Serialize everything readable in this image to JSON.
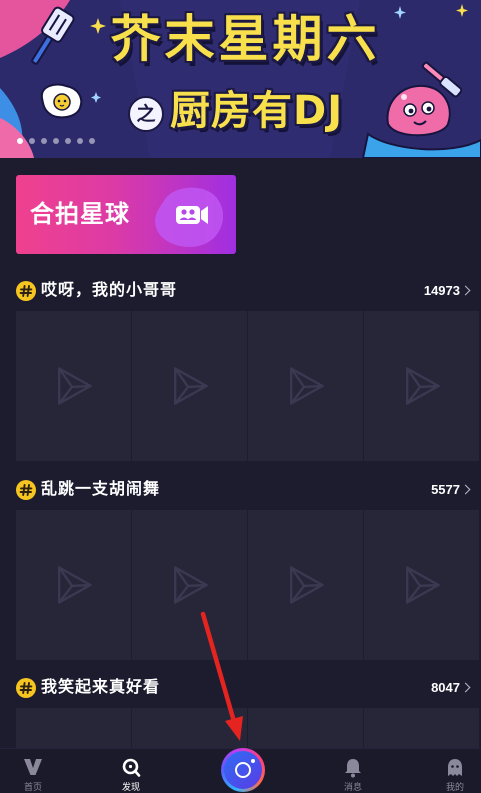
{
  "banner": {
    "title_line1": "芥末星期六",
    "connector": "之",
    "title_line2": "厨房有DJ",
    "slides": 7,
    "active_slide": 0
  },
  "duet_card": {
    "label": "合拍星球",
    "icon": "duet-camera-icon"
  },
  "topic_badge_icon": "hashtag-icon",
  "thumbnail_icon": "play-placeholder-icon",
  "topics": [
    {
      "title": "哎呀，我的小哥哥",
      "count": "14973"
    },
    {
      "title": "乱跳一支胡闹舞",
      "count": "5577"
    },
    {
      "title": "我笑起来真好看",
      "count": "8047"
    }
  ],
  "bottom_nav": {
    "items": [
      {
        "label": "首页",
        "icon": "home-v-logo-icon",
        "active": false
      },
      {
        "label": "发现",
        "icon": "discover-icon",
        "active": true
      },
      {
        "label": "",
        "icon": "camera-record-icon",
        "active": false
      },
      {
        "label": "消息",
        "icon": "bell-icon",
        "active": false
      },
      {
        "label": "我的",
        "icon": "profile-icon",
        "active": false
      }
    ]
  },
  "annotation": {
    "shape": "arrow",
    "color": "#e52420"
  },
  "colors": {
    "page_bg": "#1d1b2e",
    "tile_bg": "#272538",
    "tile_icon": "#3b3951",
    "text": "#ffffff",
    "muted": "#8a889a",
    "topic_badge": "#f6c520",
    "nav_bg": "#1b1a2a",
    "banner_title": "#f8e04c"
  }
}
